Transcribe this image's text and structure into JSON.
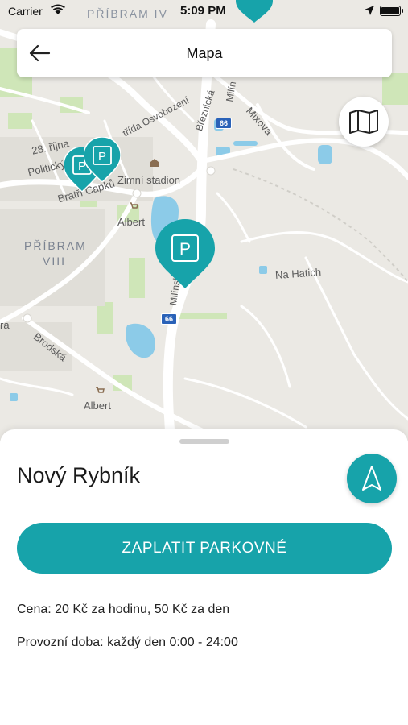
{
  "status_bar": {
    "carrier": "Carrier",
    "time": "5:09 PM",
    "town_label": "PŘÍBRAM IV"
  },
  "header": {
    "title": "Mapa"
  },
  "map": {
    "labels": {
      "street_28_rijna": "28. října",
      "politicky": "Politický",
      "bratri_capku": "Bratří Čapků",
      "trida_osvobozeni": "třída Osvobození",
      "breznicka": "Březnická",
      "milinska": "Milínská",
      "mixova": "Mixova",
      "zimni_stadion": "Zimní stadion",
      "albert_1": "Albert",
      "albert_2": "Albert",
      "pribram_viii_line1": "PŘÍBRAM",
      "pribram_viii_line2": "VIII",
      "na_hatich": "Na Hatich",
      "brodska": "Brodská",
      "milin_small": "Milín",
      "road_66_top": "66",
      "road_66_bottom": "66",
      "ra_edge": "ra"
    },
    "marker_symbol": "P",
    "icons": {
      "back": "arrow-left-icon",
      "layers": "map-icon",
      "navigate": "navigation-arrow-icon"
    }
  },
  "sheet": {
    "place_name": "Nový Rybník",
    "pay_button_label": "ZAPLATIT PARKOVNÉ",
    "price_text": "Cena: 20 Kč za hodinu, 50 Kč za den",
    "hours_text": "Provozní doba: každý den 0:00 - 24:00"
  },
  "colors": {
    "accent": "#17a3aa",
    "map_background": "#ebe9e4",
    "water": "#8ccbe8",
    "park": "#c8e2b0"
  }
}
